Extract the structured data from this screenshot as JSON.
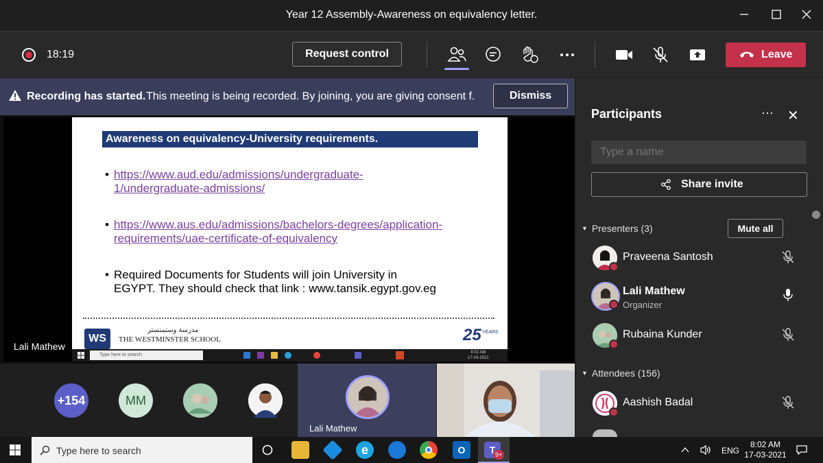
{
  "window": {
    "title": "Year 12 Assembly-Awareness on equivalency letter."
  },
  "toolbar": {
    "timer": "18:19",
    "request_control": "Request control",
    "leave": "Leave"
  },
  "banner": {
    "bold": "Recording has started.",
    "message": "This meeting is being recorded. By joining, you are giving consent f...",
    "dismiss": "Dismiss"
  },
  "slide": {
    "heading": "Awareness on equivalency-University requirements.",
    "bullet1_line1": "https://www.aud.edu/admissions/undergraduate-",
    "bullet1_line2": "1/undergraduate-admissions/",
    "bullet2_line1": "https://www.aus.edu/admissions/bachelors-degrees/application-",
    "bullet2_line2": "requirements/uae-certificate-of-equivalency",
    "bullet3_line1": "Required Documents for Students will join University in",
    "bullet3_line2": "EGYPT. They should check that link : www.tansik.egypt.gov.eg",
    "bullet_char": "•",
    "logo": "WS",
    "school_name": "THE WESTMINSTER SCHOOL",
    "school_arabic": "مدرسة وستمنستر",
    "anniversary": "25",
    "anniversary_label": "YEARS",
    "inner_search": "Type here to search",
    "inner_time": "8:02 AM",
    "inner_date": "17-03-2021"
  },
  "stage": {
    "speaker_name": "Lali Mathew"
  },
  "gallery": {
    "overflow": "+154",
    "initials": "MM",
    "active_speaker": "Lali Mathew"
  },
  "panel": {
    "title": "Participants",
    "more": "···",
    "close": "✕",
    "search_placeholder": "Type a name",
    "share_invite": "Share invite",
    "presenters_label": "Presenters (3)",
    "mute_all": "Mute all",
    "attendees_label": "Attendees (156)",
    "presenters": [
      {
        "name": "Praveena Santosh",
        "role": "",
        "mic": "muted"
      },
      {
        "name": "Lali Mathew",
        "role": "Organizer",
        "mic": "on"
      },
      {
        "name": "Rubaina Kunder",
        "role": "",
        "mic": "muted"
      }
    ],
    "attendees": [
      {
        "name": "Aashish Badal",
        "mic": "muted"
      }
    ]
  },
  "taskbar": {
    "search": "Type here to search",
    "badge": "9+",
    "lang": "ENG",
    "time": "8:02 AM",
    "date": "17-03-2021"
  },
  "colors": {
    "leave": "#c4314b",
    "banner": "#3b3e5b",
    "accent": "#9ea2ff",
    "link": "#7b3fa1",
    "slide_head": "#1f3a75"
  }
}
